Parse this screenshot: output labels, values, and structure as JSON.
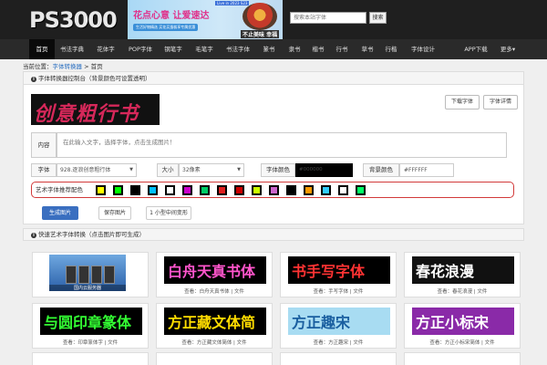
{
  "header": {
    "logo": "PS3000",
    "banner_title": "花点心意 让爱速达",
    "banner_sub": "生活好物精选 买花买蛋糕享专属优惠",
    "banner_slogan": "不止美味 幸福",
    "banner_tag": "Live in 2023 S23",
    "search_placeholder": "搜索本站字体",
    "search_button": "搜索"
  },
  "nav": {
    "items": [
      "首页",
      "书法字典",
      "花体字",
      "POP字体",
      "钢笔字",
      "毛笔字",
      "书法字体",
      "篆书",
      "隶书",
      "楷书",
      "行书",
      "草书",
      "行楷",
      "字体设计",
      "APP下载",
      "更多▾"
    ]
  },
  "breadcrumb": {
    "prefix": "当前位置：",
    "link": "字体转换器",
    "sep": " > ",
    "current": "首页"
  },
  "panel": {
    "title": "字体转换器控制台（背景颜色可设置透明）",
    "preview_text": "创意粗行书",
    "download_button": "下载字体",
    "detail_button": "字体详情",
    "content_label": "内容",
    "content_placeholder": "在此输入文字，选择字体，点击生成图片！",
    "font_label": "字体",
    "font_value": "928.逐浪创意粗行体",
    "size_label": "大小",
    "size_value": "32像素",
    "fg_label": "字体颜色",
    "fg_value": "#000000",
    "bg_label": "背景颜色",
    "bg_value": "#FFFFFF",
    "scheme_label": "艺术字体推荐配色",
    "generate_button": "生成图片",
    "save_button": "保存图片",
    "small_image_option": "1 小型中间变形"
  },
  "colors": {
    "accent": "#3a6fc0",
    "preview_text": "#d6285a",
    "swatches": [
      [
        "#ffff00",
        "#000000"
      ],
      [
        "#00ff00",
        "#000000"
      ],
      [
        "#000000",
        "#00ff00"
      ],
      [
        "#00bfff",
        "#ffffff"
      ],
      [
        "#ffffff",
        "#000000"
      ],
      [
        "#cc00cc",
        "#000000"
      ],
      [
        "#00cc66",
        "#000000"
      ],
      [
        "#e02020",
        "#000000"
      ],
      [
        "#cc0000",
        "#000000"
      ],
      [
        "#ccff00",
        "#ffffff"
      ],
      [
        "#cc66cc",
        "#000000"
      ],
      [
        "#000000",
        "#ffffff"
      ],
      [
        "#ff9900",
        "#000000"
      ],
      [
        "#33ccff",
        "#000000"
      ],
      [
        "#ffffff",
        "#000000"
      ],
      [
        "#00ff66",
        "#000000"
      ]
    ]
  },
  "quick": {
    "title": "快速艺术字体转换（点击图片即可生成）",
    "cards": [
      {
        "text": "",
        "caption": "",
        "fg": "#ffffff",
        "bg": "#3a78c8",
        "server": true,
        "server_label": "国内云服务器"
      },
      {
        "text": "白舟天真书体",
        "caption": "查看：白舟天真书体 | 文件",
        "fg": "#ff55cc",
        "bg": "#000000"
      },
      {
        "text": "书手写字体",
        "caption": "查看：手写字体 | 文件",
        "fg": "#ff3333",
        "bg": "#000000"
      },
      {
        "text": "春花浪漫",
        "caption": "查看：春花浪漫 | 文件",
        "fg": "#ffffff",
        "bg": "#111111"
      },
      {
        "text": "与圆印章篆体",
        "caption": "查看：印章篆体字 | 文件",
        "fg": "#33ff33",
        "bg": "#000000"
      },
      {
        "text": "方正藏文体简",
        "caption": "查看：方正藏文体简体 | 文件",
        "fg": "#ffdd00",
        "bg": "#000000"
      },
      {
        "text": "方正趣宋",
        "caption": "查看：方正趣宋 | 文件",
        "fg": "#1a5fa0",
        "bg": "#a8dcf2"
      },
      {
        "text": "方正小标宋",
        "caption": "查看：方正小标宋简体 | 文件",
        "fg": "#ffffff",
        "bg": "#8a2aa8"
      }
    ]
  }
}
